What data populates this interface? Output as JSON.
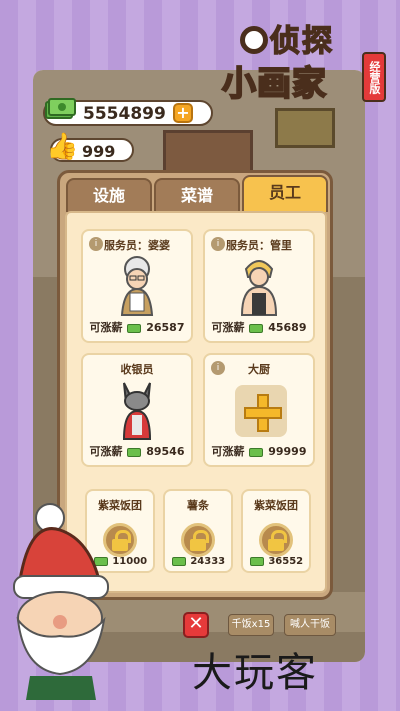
{
  "logo": {
    "line1": "侦探",
    "line2": "小画家",
    "tag": "经营版"
  },
  "currency": {
    "cash": "5554899",
    "likes": "999"
  },
  "tabs": [
    {
      "label": "设施",
      "active": false
    },
    {
      "label": "菜谱",
      "active": false
    },
    {
      "label": "员工",
      "active": true
    }
  ],
  "staff": [
    {
      "title": "服务员：婆婆",
      "salary_label": "可涨薪",
      "salary": "26587"
    },
    {
      "title": "服务员：管里",
      "salary_label": "可涨薪",
      "salary": "45689"
    },
    {
      "title": "收银员",
      "salary_label": "可涨薪",
      "salary": "89546"
    },
    {
      "title": "大厨",
      "salary_label": "可涨薪",
      "salary": "99999"
    }
  ],
  "locked": [
    {
      "title": "紫菜饭团",
      "cost": "11000"
    },
    {
      "title": "薯条",
      "cost": "24333"
    },
    {
      "title": "紫菜饭团",
      "cost": "36552"
    }
  ],
  "bottom": {
    "close": "✕",
    "pill1": "千饭x15",
    "pill2": "喊人干饭"
  },
  "watermark": "大玩客",
  "colors": {
    "accent": "#f7c24e",
    "panel": "#c9a77e",
    "background": "#b89ad8"
  }
}
